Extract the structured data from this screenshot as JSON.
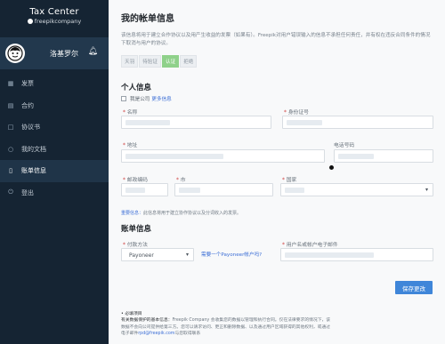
{
  "brand": {
    "title": "Tax Center",
    "subtitle": "freepikcompany"
  },
  "user": {
    "name": "洛基罗尔"
  },
  "nav": [
    {
      "label": "发票",
      "icon": "invoice-icon"
    },
    {
      "label": "合约",
      "icon": "contract-icon"
    },
    {
      "label": "协议书",
      "icon": "agreement-icon"
    },
    {
      "label": "我的文档",
      "icon": "documents-icon"
    },
    {
      "label": "账单信息",
      "icon": "billing-icon",
      "active": true
    },
    {
      "label": "登出",
      "icon": "logout-icon"
    }
  ],
  "page": {
    "title": "我的帐单信息",
    "description": "该信息将用于建立合作协议以及用产生收益的发票（如果有）。Freepik对用户错误输入的信息不承担任何责任，并有权在违反合同条件的情况下取消与用户的协议。",
    "tabs": [
      "天羽",
      "待验证",
      "认证",
      "拒绝"
    ]
  },
  "personal": {
    "heading": "个人信息",
    "company_checkbox": "我是公司",
    "more_info": "更多信息",
    "fields": {
      "name": "名称",
      "id_number": "身份证号",
      "address": "地址",
      "phone": "电话号码",
      "postal_code": "邮政编码",
      "city": "市",
      "country": "国家"
    },
    "notice_strong": "重要信息：",
    "notice": "此信息将用于建立协作协议以及分词收入的发票。"
  },
  "account": {
    "heading": "账单信息",
    "payment_method_label": "付款方法",
    "payment_method_value": "Payoneer",
    "need_account_link": "需要一个Payoneer帐户吗?",
    "email_label": "用户名或帐户电子邮件"
  },
  "actions": {
    "save": "保存更改"
  },
  "footer": {
    "title": "必填项目",
    "line1_strong": "有关数据保护的基本信息：",
    "line1": "Freepik Company 会收集您的数据以管理和执行合同。仅在法律要求的情况下，该",
    "line2": "数据不会向公司提供给第三方。您可以请求访问、更正和删除数据、以及通过用户区域获得的其他权利，或通过",
    "line3_pre": "电子邮件",
    "line3_link": "rpd@freepik.com",
    "line3_post": "与您取得联系"
  }
}
